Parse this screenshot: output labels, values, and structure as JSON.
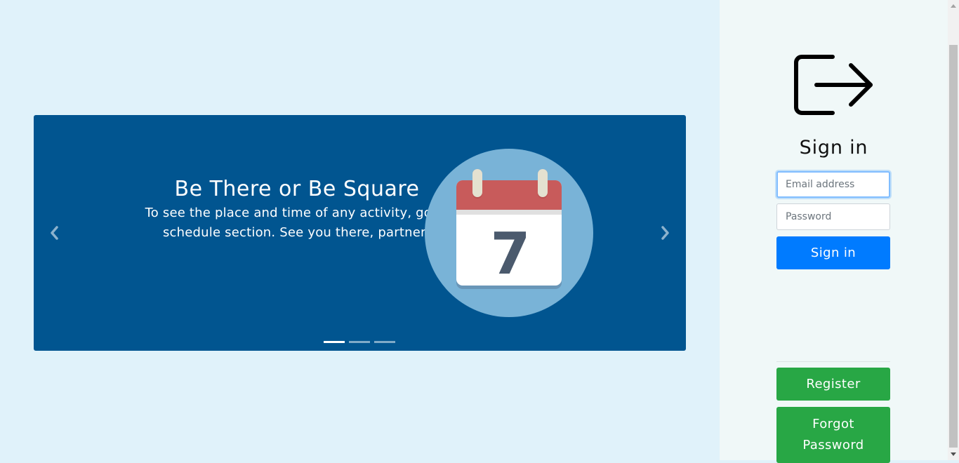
{
  "carousel": {
    "slide_title": "Be There or Be Square",
    "slide_description": "To see the place and time of any activity, go to schedule section. See you there, partner!",
    "calendar_day": "7",
    "prev_icon": "chevron-left-icon",
    "next_icon": "chevron-right-icon",
    "indicators": [
      {
        "active": true
      },
      {
        "active": false
      },
      {
        "active": false
      }
    ],
    "colors": {
      "background": "#015590",
      "circle": "#79b3d7",
      "calendar_header": "#c85b5b"
    }
  },
  "sidebar": {
    "icon": "logout-icon",
    "title": "Sign in",
    "email_placeholder": "Email address",
    "password_placeholder": "Password",
    "signin_label": "Sign in",
    "register_label": "Register",
    "forgot_label": "Forgot Password"
  },
  "colors": {
    "page_background": "#e0f2fa",
    "sidebar_background": "#f0f8f8",
    "primary": "#007bff",
    "success": "#28a745"
  }
}
